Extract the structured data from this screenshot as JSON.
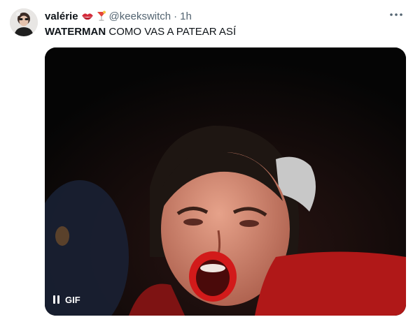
{
  "tweet": {
    "display_name": "valérie",
    "handle": "@keekswitch",
    "separator": "·",
    "time": "1h",
    "text_bold": "WATERMAN",
    "text_rest": " COMO VAS A PATEAR ASÍ"
  },
  "media": {
    "badge_label": "GIF"
  },
  "icons": {
    "name_emojis": [
      "kiss-mark-icon",
      "cocktail-icon"
    ],
    "more": "more-horizontal-icon",
    "pause": "pause-icon"
  },
  "colors": {
    "text_primary": "#0f1419",
    "text_secondary": "#536471",
    "media_background": "#050505"
  }
}
